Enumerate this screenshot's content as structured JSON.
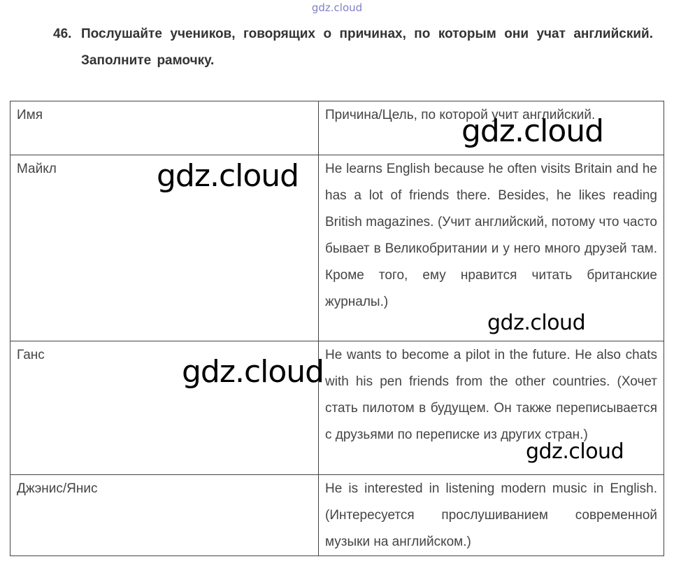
{
  "watermark_top": "gdz.cloud",
  "task": {
    "number": "46.",
    "text": "Послушайте учеников, говорящих о причинах, по которым они учат английский. Заполните рамочку."
  },
  "table": {
    "headers": {
      "name": "Имя",
      "reason": "Причина/Цель, по которой учит английский."
    },
    "rows": [
      {
        "name": "Майкл",
        "reason": "He learns English because he often visits Britain and he has a lot of friends there. Besides, he likes reading British magazines. (Учит английский, потому что часто бывает в Великобритании и у него много друзей там. Кроме того, ему нравится читать британские журналы.)"
      },
      {
        "name": "Ганс",
        "reason": "He wants to become a pilot in the future. He also chats with his pen friends from the other countries. (Хочет стать пилотом в будущем. Он также переписывается с друзьями по переписке из других стран.)"
      },
      {
        "name": "Джэнис/Янис",
        "reason": "He is interested in listening modern music in English. (Интересуется прослушиванием современной музыки на английском.)"
      }
    ]
  },
  "watermarks": [
    "gdz.cloud",
    "gdz.cloud",
    "gdz.cloud",
    "gdz.cloud",
    "gdz.cloud"
  ]
}
